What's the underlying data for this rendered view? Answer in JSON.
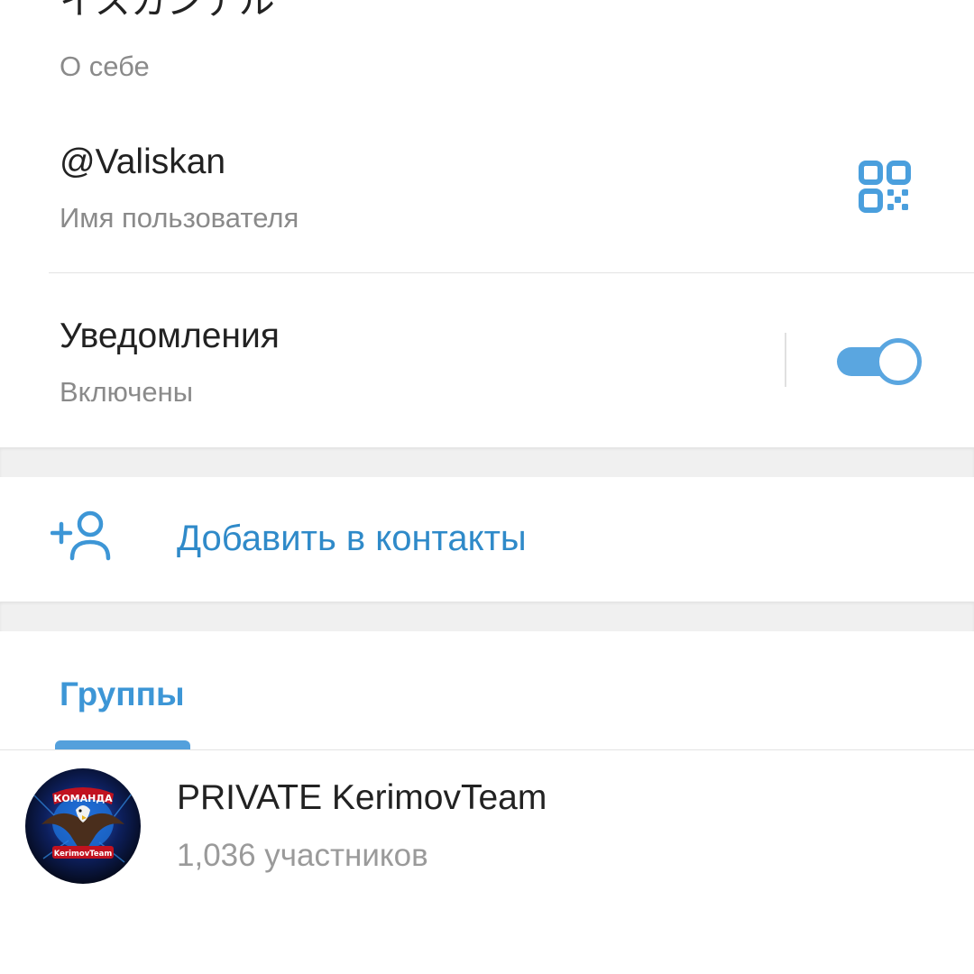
{
  "profile": {
    "bio": {
      "value": "イスカンデル",
      "label": "О себе"
    },
    "username": {
      "value": "@Valiskan",
      "label": "Имя пользователя",
      "qr_icon": "qr-code-icon"
    },
    "notifications": {
      "title": "Уведомления",
      "status": "Включены",
      "enabled": true
    }
  },
  "actions": {
    "add_contact": {
      "label": "Добавить в контакты",
      "icon": "add-person-icon"
    }
  },
  "tabs": [
    {
      "label": "Группы",
      "active": true
    }
  ],
  "groups": [
    {
      "name": "PRIVATE KerimovTeam",
      "members": "1,036 участников",
      "avatar_text_top": "КОМАНДА",
      "avatar_text_bottom": "KerimovTeam"
    }
  ],
  "colors": {
    "accent": "#2f8ac9",
    "tab_accent": "#3d96d6",
    "toggle": "#5aa6e0",
    "primary_text": "#222222",
    "secondary_text": "#8a8a8a",
    "separator": "#f0f0f0"
  }
}
